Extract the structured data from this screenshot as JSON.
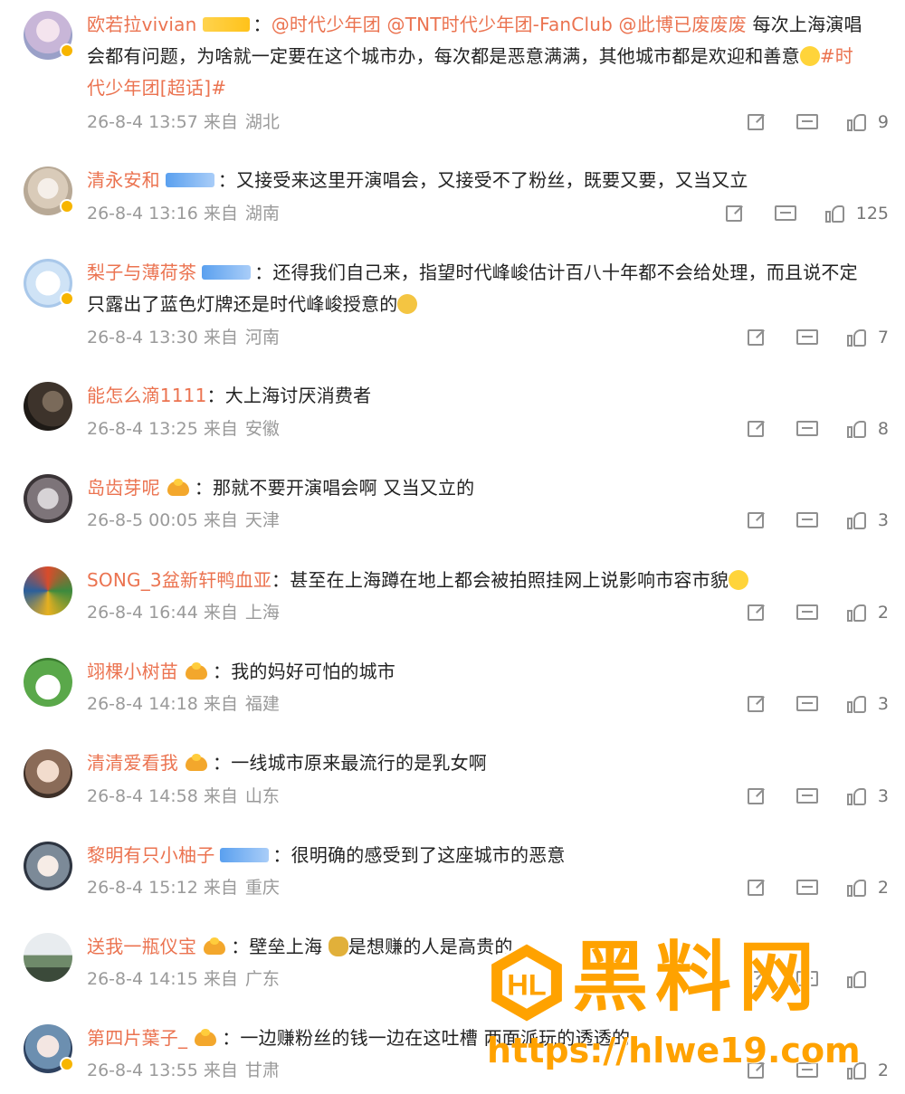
{
  "comments": [
    {
      "name": "欧若拉vivian",
      "badge": "gold",
      "sep": "：",
      "mention": "@时代少年团 @TNT时代少年团-FanClub @此博已废废废",
      "content1": " 每次上海演唱",
      "content2": "会都有问题，为啥就一定要在这个城市办，每次都是恶意满满，其他城市都是欢迎和善意",
      "topic_a": "#时",
      "topic_b": "代少年团[超话]#",
      "time": "26-8-4 13:57 来自",
      "region": "湖北",
      "likes": "9"
    },
    {
      "name": "清永安和",
      "badge": "blue",
      "sep": "：",
      "content1": "又接受来这里开演唱会，又接受不了粉丝，既要又要，又当又立",
      "time": "26-8-4 13:16 来自",
      "region": "湖南",
      "likes": "125"
    },
    {
      "name": "梨子与薄荷茶",
      "badge": "blue",
      "sep": "：",
      "content1": "还得我们自己来，指望时代峰峻估计百八十年都不会给处理，而且说不定",
      "content2": "只露出了蓝色灯牌还是时代峰峻授意的",
      "time": "26-8-4 13:30 来自",
      "region": "河南",
      "likes": "7"
    },
    {
      "name": "能怎么滴1111",
      "sep": "：",
      "content1": "大上海讨厌消费者",
      "time": "26-8-4 13:25 来自",
      "region": "安徽",
      "likes": "8"
    },
    {
      "name": "岛齿芽呢",
      "badge": "crown",
      "sep": "：",
      "content1": "那就不要开演唱会啊 又当又立的",
      "time": "26-8-5 00:05 来自",
      "region": "天津",
      "likes": "3"
    },
    {
      "name": "SONG_3盆新轩鸭血亚",
      "sep": "：",
      "content1": "甚至在上海蹲在地上都会被拍照挂网上说影响市容市貌",
      "time": "26-8-4 16:44 来自",
      "region": "上海",
      "likes": "2"
    },
    {
      "name": "翊棵小树苗",
      "badge": "crown",
      "sep": "：",
      "content1": "我的妈好可怕的城市",
      "time": "26-8-4 14:18 来自",
      "region": "福建",
      "likes": "3"
    },
    {
      "name": "清清爱看我",
      "badge": "crown",
      "sep": "：",
      "content1": "一线城市原来最流行的是乳女啊",
      "time": "26-8-4 14:58 来自",
      "region": "山东",
      "likes": "3"
    },
    {
      "name": "黎明有只小柚子",
      "badge": "blue",
      "sep": "：",
      "content1": "很明确的感受到了这座城市的恶意",
      "time": "26-8-4 15:12 来自",
      "region": "重庆",
      "likes": "2"
    },
    {
      "name": "送我一瓶仪宝",
      "badge": "crown",
      "sep": "：",
      "content1": "壁垒上海",
      "content1b": "是想赚的人是高贵的",
      "time": "26-8-4 14:15 来自",
      "region": "广东",
      "likes": ""
    },
    {
      "name": "第四片葉子_",
      "badge": "crown",
      "sep": "：",
      "content1": "一边赚粉丝的钱一边在这吐槽 两面派玩的透透的",
      "time": "26-8-4 13:55 来自",
      "region": "甘肃",
      "likes": "2"
    }
  ],
  "watermark": {
    "title": "黑料网",
    "url": "https://hlwe19.com"
  },
  "colors": {
    "username": "#eb7350",
    "meta": "#9a9a9a",
    "watermark": "#ffa200"
  }
}
